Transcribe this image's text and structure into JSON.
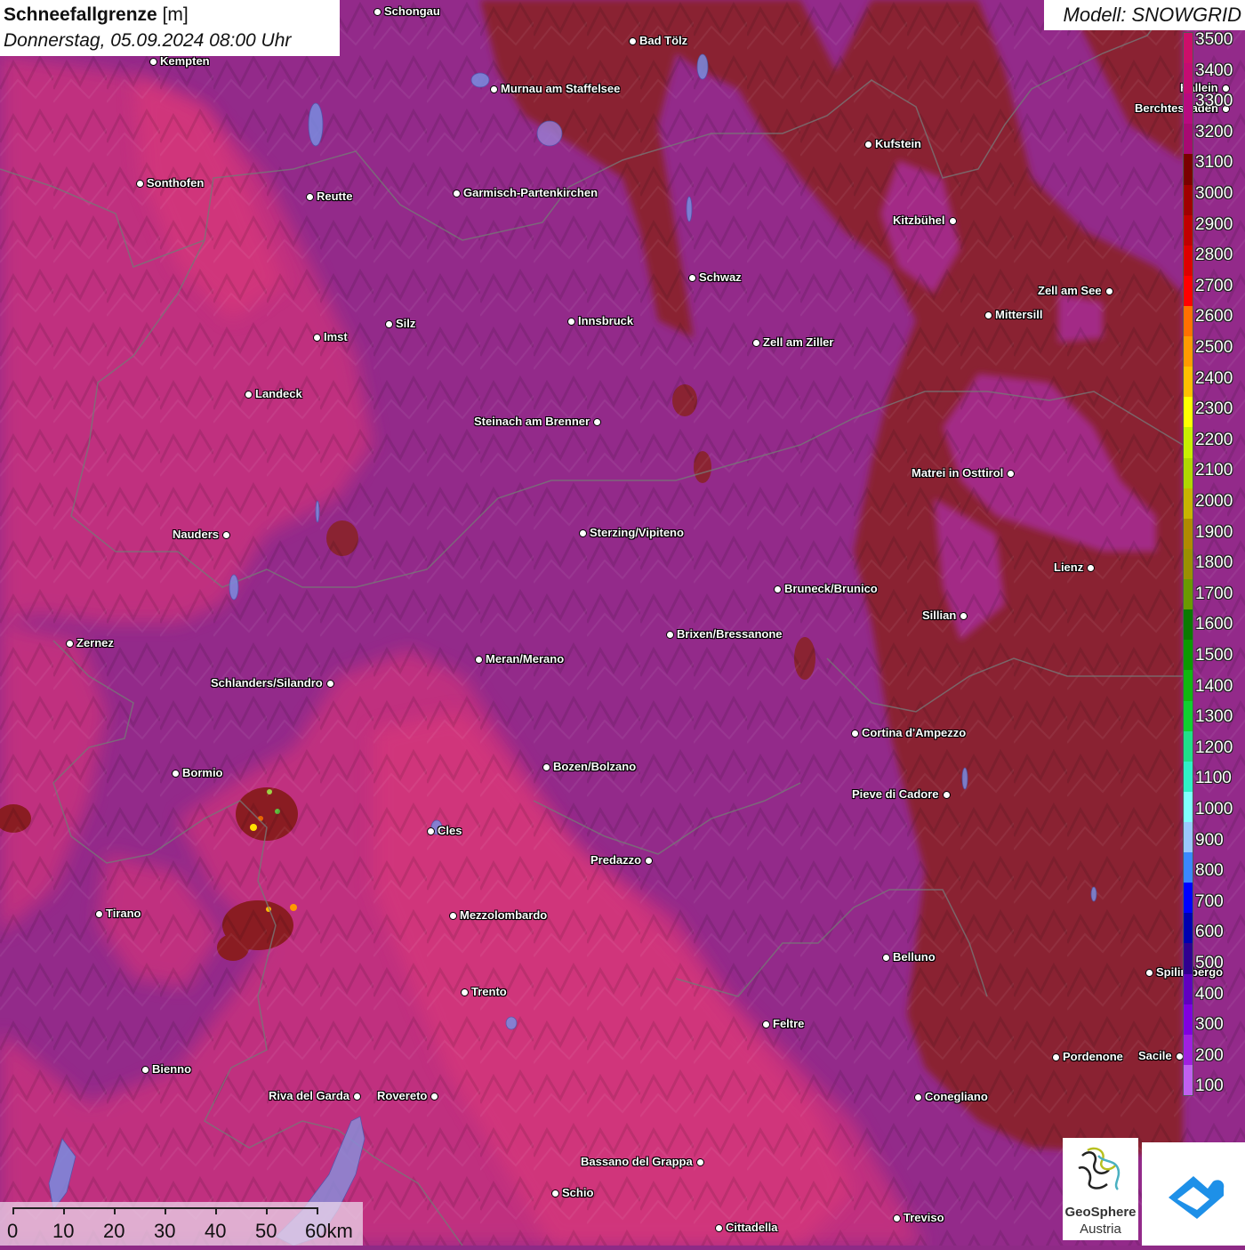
{
  "title": {
    "parameter": "Schneefallgrenze",
    "unit": "[m]",
    "datetime": "Donnerstag, 05.09.2024 08:00 Uhr"
  },
  "model": "Modell: SNOWGRID",
  "legend": {
    "labels": [
      "3500",
      "3400",
      "3300",
      "3200",
      "3100",
      "3000",
      "2900",
      "2800",
      "2700",
      "2600",
      "2500",
      "2400",
      "2300",
      "2200",
      "2100",
      "2000",
      "1900",
      "1800",
      "1700",
      "1600",
      "1500",
      "1400",
      "1300",
      "1200",
      "1100",
      "1000",
      "900",
      "800",
      "700",
      "600",
      "500",
      "400",
      "300",
      "200",
      "100"
    ],
    "colors": [
      "#cc0f6a",
      "#c40c72",
      "#b80a80",
      "#a80a72",
      "#7a0000",
      "#a00000",
      "#c00000",
      "#dd0000",
      "#ff0000",
      "#ff7000",
      "#ff9a00",
      "#ffbf00",
      "#ffff00",
      "#c8f000",
      "#b0d800",
      "#c8b400",
      "#b08a00",
      "#9a9000",
      "#6a9a00",
      "#0a7a00",
      "#0a9a00",
      "#10b810",
      "#10d030",
      "#20e08a",
      "#30f0c8",
      "#80ffff",
      "#9ac8ff",
      "#3a88ff",
      "#0000ff",
      "#0000b0",
      "#300090",
      "#6000c0",
      "#8000e0",
      "#a020e0",
      "#c060f0"
    ]
  },
  "cities": [
    {
      "name": "Schongau"
    },
    {
      "name": "Bad Tölz"
    },
    {
      "name": "Kempten"
    },
    {
      "name": "Murnau am Staffelsee"
    },
    {
      "name": "Kufstein"
    },
    {
      "name": "Berchtesgaden"
    },
    {
      "name": "Sonthofen"
    },
    {
      "name": "Reutte"
    },
    {
      "name": "Garmisch-Partenkirchen"
    },
    {
      "name": "Kitzbühel"
    },
    {
      "name": "Schwaz"
    },
    {
      "name": "Zell am See"
    },
    {
      "name": "Innsbruck"
    },
    {
      "name": "Mittersill"
    },
    {
      "name": "Imst"
    },
    {
      "name": "Silz"
    },
    {
      "name": "Zell am Ziller"
    },
    {
      "name": "Landeck"
    },
    {
      "name": "Steinach am Brenner"
    },
    {
      "name": "Matrei in Osttirol"
    },
    {
      "name": "Nauders"
    },
    {
      "name": "Sterzing/Vipiteno"
    },
    {
      "name": "Lienz"
    },
    {
      "name": "Bruneck/Brunico"
    },
    {
      "name": "Sillian"
    },
    {
      "name": "Zernez"
    },
    {
      "name": "Brixen/Bressanone"
    },
    {
      "name": "Meran/Merano"
    },
    {
      "name": "Schlanders/Silandro"
    },
    {
      "name": "Cortina d'Ampezzo"
    },
    {
      "name": "Bozen/Bolzano"
    },
    {
      "name": "Bormio"
    },
    {
      "name": "Pieve di Cadore"
    },
    {
      "name": "Cles"
    },
    {
      "name": "Predazzo"
    },
    {
      "name": "Tirano"
    },
    {
      "name": "Mezzolombardo"
    },
    {
      "name": "Belluno"
    },
    {
      "name": "Spilimbergo"
    },
    {
      "name": "Trento"
    },
    {
      "name": "Feltre"
    },
    {
      "name": "Pordenone"
    },
    {
      "name": "Bienno"
    },
    {
      "name": "Riva del Garda"
    },
    {
      "name": "Rovereto"
    },
    {
      "name": "Conegliano"
    },
    {
      "name": "Bassano del Grappa"
    },
    {
      "name": "Schio"
    },
    {
      "name": "Treviso"
    },
    {
      "name": "Cittadella"
    },
    {
      "name": "Hallein"
    },
    {
      "name": "Sacile"
    }
  ],
  "scale_bar": {
    "labels": [
      "0",
      "10",
      "20",
      "30",
      "40",
      "50",
      "60km"
    ]
  },
  "logos": {
    "geosphere_name": "GeoSphere",
    "geosphere_sub": "Austria"
  }
}
